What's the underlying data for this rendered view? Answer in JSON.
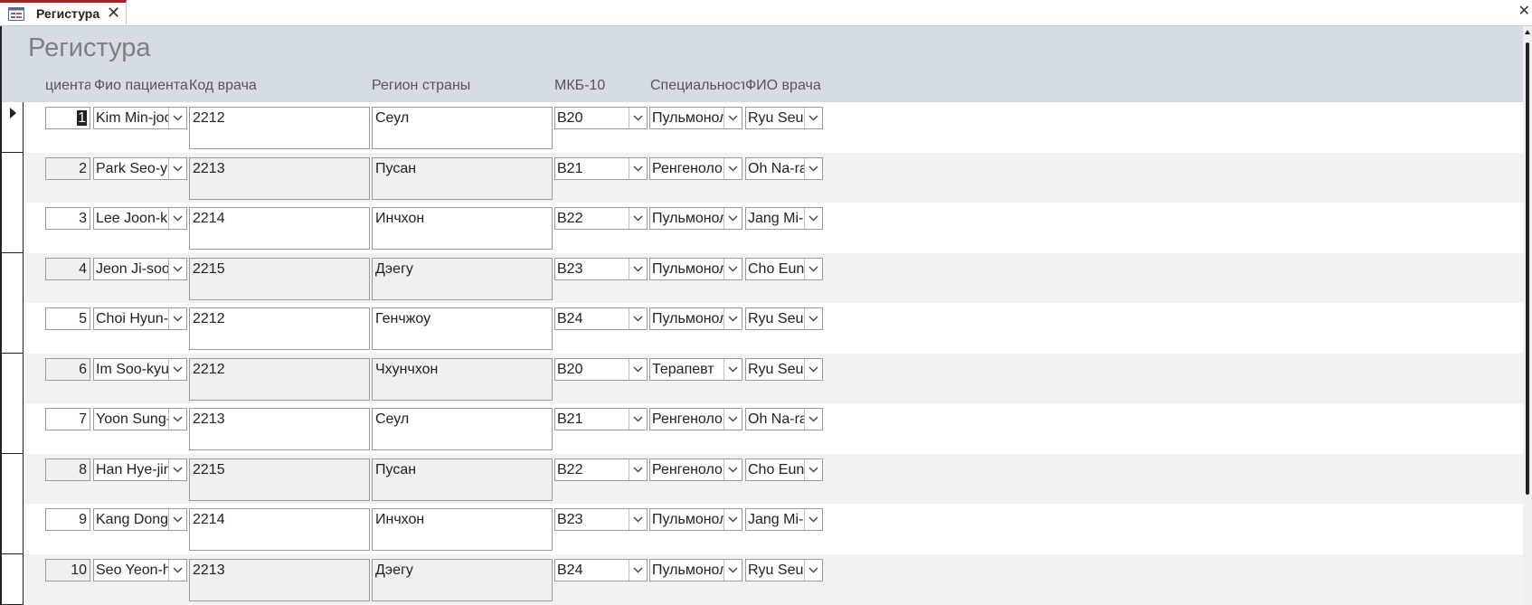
{
  "tab": {
    "label": "Регистура",
    "close": "✕"
  },
  "window": {
    "close": "✕"
  },
  "form": {
    "title": "Регистура"
  },
  "columns": {
    "id": "циента",
    "patient": "Фио пациента",
    "doctor_code": "Код врача",
    "region": "Регион страны",
    "icd10": "МКБ-10",
    "specialty": "Специальност",
    "doctor_name": "ФИО врача"
  },
  "rows": [
    {
      "id": "1",
      "patient": "Kim Min-joo",
      "doctor_code": "2212",
      "region": "Сеул",
      "icd10": "B20",
      "specialty": "Пульмонол",
      "doctor_name": "Ryu Seun"
    },
    {
      "id": "2",
      "patient": "Park Seo-ye",
      "doctor_code": "2213",
      "region": "Пусан",
      "icd10": "B21",
      "specialty": "Ренгенолог",
      "doctor_name": "Oh Na-ra"
    },
    {
      "id": "3",
      "patient": "Lee Joon-ki",
      "doctor_code": "2214",
      "region": "Инчхон",
      "icd10": "B22",
      "specialty": "Пульмонол",
      "doctor_name": "Jang Mi-k"
    },
    {
      "id": "4",
      "patient": "Jeon Ji-soo",
      "doctor_code": "2215",
      "region": "Дэегу",
      "icd10": "B23",
      "specialty": "Пульмонол",
      "doctor_name": "Cho Eun-"
    },
    {
      "id": "5",
      "patient": "Choi Hyun-w",
      "doctor_code": "2212",
      "region": "Генчжоу",
      "icd10": "B24",
      "specialty": "Пульмонол",
      "doctor_name": "Ryu Seun"
    },
    {
      "id": "6",
      "patient": "Im Soo-kyun",
      "doctor_code": "2212",
      "region": "Чхунчхон",
      "icd10": "B20",
      "specialty": "Терапевт",
      "doctor_name": "Ryu Seun"
    },
    {
      "id": "7",
      "patient": "Yoon Sung-j",
      "doctor_code": "2213",
      "region": "Сеул",
      "icd10": "B21",
      "specialty": "Ренгенолог",
      "doctor_name": "Oh Na-ra"
    },
    {
      "id": "8",
      "patient": "Han Hye-jin",
      "doctor_code": "2215",
      "region": "Пусан",
      "icd10": "B22",
      "specialty": "Ренгенолог",
      "doctor_name": "Cho Eun-"
    },
    {
      "id": "9",
      "patient": "Kang Dong-",
      "doctor_code": "2214",
      "region": "Инчхон",
      "icd10": "B23",
      "specialty": "Пульмонол",
      "doctor_name": "Jang Mi-k"
    },
    {
      "id": "10",
      "patient": "Seo Yeon-h",
      "doctor_code": "2213",
      "region": "Дэегу",
      "icd10": "B24",
      "specialty": "Пульмонол",
      "doctor_name": "Ryu Seun"
    }
  ],
  "colors": {
    "header_bg": "#d6dce5",
    "alt_row_bg": "#f2f2f2",
    "tab_accent": "#a4262c"
  },
  "icons": {
    "tab": "form-icon",
    "dropdown": "chevron-down-icon",
    "record_selector": "current-record-arrow-icon"
  }
}
